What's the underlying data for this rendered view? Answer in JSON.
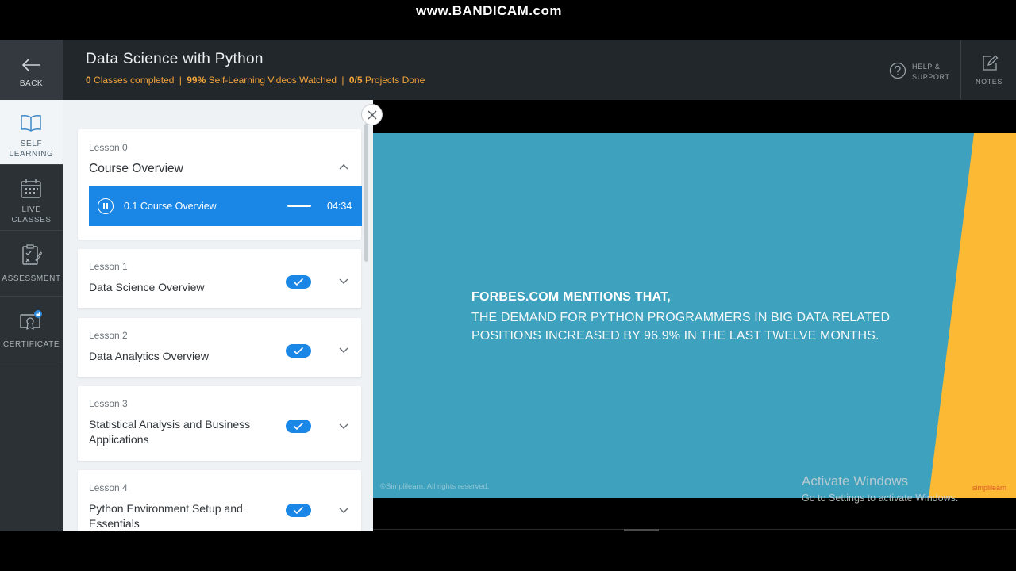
{
  "recorder_watermark": "www.BANDICAM.com",
  "header": {
    "back_label": "BACK",
    "course_title": "Data Science with Python",
    "stats": {
      "classes_value": "0",
      "classes_label": "Classes completed",
      "videos_value": "99%",
      "videos_label": "Self-Learning Videos Watched",
      "projects_value": "0/5",
      "projects_label": "Projects Done",
      "separator": "|"
    },
    "help_line1": "HELP &",
    "help_line2": "SUPPORT",
    "notes_label": "NOTES",
    "accent_color": "#f3a33a"
  },
  "left_nav": [
    {
      "line1": "SELF",
      "line2": "LEARNING",
      "icon": "book-icon",
      "active": true
    },
    {
      "line1": "LIVE",
      "line2": "CLASSES",
      "icon": "calendar-icon",
      "active": false
    },
    {
      "line1": "ASSESSMENT",
      "line2": "",
      "icon": "assessment-icon",
      "active": false
    },
    {
      "line1": "CERTIFICATE",
      "line2": "",
      "icon": "certificate-lock-icon",
      "active": false
    }
  ],
  "lessons": [
    {
      "number": "Lesson 0",
      "title": "Course Overview",
      "expanded": true,
      "video": {
        "title": "0.1 Course Overview",
        "duration": "04:34"
      }
    },
    {
      "number": "Lesson 1",
      "title": "Data Science Overview",
      "completed": true
    },
    {
      "number": "Lesson 2",
      "title": "Data Analytics Overview",
      "completed": true
    },
    {
      "number": "Lesson 3",
      "title": "Statistical Analysis and Business Applications",
      "completed": true
    },
    {
      "number": "Lesson 4",
      "title": "Python Environment Setup and Essentials",
      "completed": true
    }
  ],
  "slide": {
    "heading": "FORBES.COM MENTIONS THAT,",
    "body": "THE DEMAND FOR PYTHON PROGRAMMERS IN BIG DATA RELATED POSITIONS INCREASED BY 96.9% IN THE LAST TWELVE MONTHS.",
    "copyright": "©Simplilearn. All rights reserved.",
    "brand": "simplilearn",
    "background_color": "#3ea1bd",
    "stripe_color": "#fbb934"
  },
  "os_overlay": {
    "line1": "Activate Windows",
    "line2": "Go to Settings to activate Windows."
  },
  "colors": {
    "primary_blue": "#1a86e6",
    "header_bg": "#22272b",
    "nav_bg": "#2b3135"
  }
}
